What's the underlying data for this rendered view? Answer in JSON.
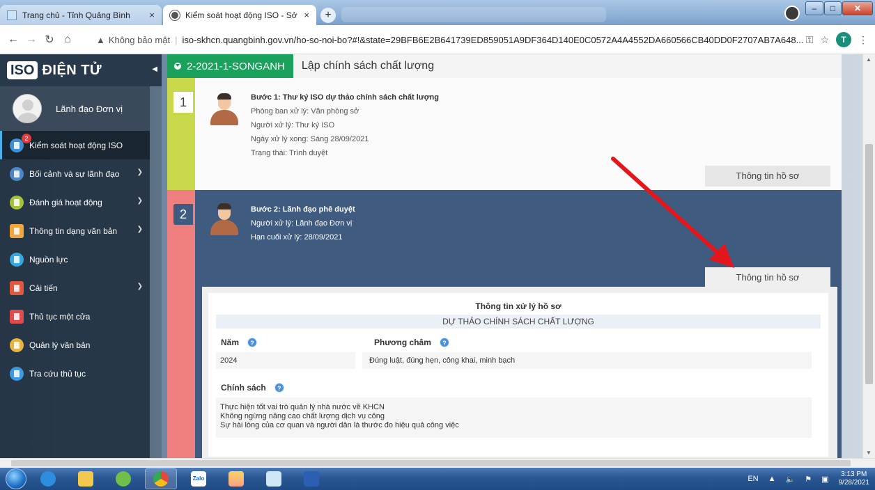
{
  "browser": {
    "tabs": [
      {
        "title": "Trang chủ - Tỉnh Quảng Bình",
        "active": false
      },
      {
        "title": "Kiểm soát hoạt động ISO - Sở Kh",
        "active": true
      }
    ],
    "new_tab_label": "+",
    "close_glyph": "×",
    "security_text": "Không bảo mật",
    "url": "iso-skhcn.quangbinh.gov.vn/ho-so-noi-bo?#!&state=29BFB6E2B641739ED859051A9DF364D140E0C0572A4A4552DA660566CB40DD0F2707AB7A648...",
    "profile_initial": "T"
  },
  "sidebar": {
    "logo_iso": "ISO",
    "logo_rest": "ĐIỆN TỬ",
    "user_name": "Lãnh đạo Đơn vị",
    "items": [
      {
        "label": "Kiểm soát hoạt động ISO",
        "badge": "2",
        "color": "#3f8fd4",
        "icon": "iso-icon",
        "expandable": false,
        "active": true
      },
      {
        "label": "Bối cảnh và sự lãnh đạo",
        "color": "#4b86c6",
        "icon": "document-icon",
        "expandable": true
      },
      {
        "label": "Đánh giá hoạt động",
        "color": "#a6c43a",
        "icon": "clipboard-icon",
        "expandable": true
      },
      {
        "label": "Thông tin dạng văn bản",
        "color": "#f0a63a",
        "icon": "file-text-icon",
        "expandable": true
      },
      {
        "label": "Nguồn lực",
        "color": "#35a8e0",
        "icon": "users-icon",
        "expandable": false
      },
      {
        "label": "Cải tiến",
        "color": "#e2573e",
        "icon": "chart-icon",
        "expandable": true
      },
      {
        "label": "Thủ tục một cửa",
        "color": "#e04a4a",
        "icon": "procedure-icon",
        "expandable": false
      },
      {
        "label": "Quản lý văn bản",
        "color": "#e8b43c",
        "icon": "folder-icon",
        "expandable": false
      },
      {
        "label": "Tra cứu thủ tục",
        "color": "#3a9be0",
        "icon": "search-icon",
        "expandable": false
      }
    ]
  },
  "header": {
    "code": "2-2021-1-SONGANH",
    "title": "Lập chính sách chất lượng"
  },
  "steps": [
    {
      "number": "1",
      "title": "Bước 1: Thư ký ISO dự thảo chính sách chất lượng",
      "lines": [
        "Phòng ban xử lý: Văn phòng sở",
        "Người xử lý: Thư ký ISO",
        "Ngày xử lý xong: Sáng 28/09/2021",
        "Trạng thái: Trình duyệt"
      ],
      "button": "Thông tin hồ sơ",
      "bar_color": "#c8d84a"
    },
    {
      "number": "2",
      "title": "Bước 2: Lãnh đạo phê duyệt",
      "lines": [
        "Người xử lý: Lãnh đạo Đơn vị",
        "Hạn cuối xử lý: 28/09/2021"
      ],
      "button": "Thông tin hồ sơ",
      "bar_color": "#ef7f7f"
    }
  ],
  "record_panel": {
    "heading": "Thông tin xử lý hồ sơ",
    "subheading": "DỰ THẢO CHÍNH SÁCH CHẤT LƯỢNG",
    "help_glyph": "?",
    "year_label": "Năm",
    "year_value": "2024",
    "motto_label": "Phương châm",
    "motto_value": "Đúng luật, đúng hẹn, công khai, minh bạch",
    "policy_label": "Chính sách",
    "policy_lines": [
      "Thực hiện tốt vai trò quản lý nhà nước về KHCN",
      "Không ngừng nâng cao chất lượng dịch vụ công",
      "Sự hài lòng của cơ quan và người dân là thước đo hiệu quả công việc"
    ]
  },
  "taskbar": {
    "apps": [
      "ie-icon",
      "explorer-icon",
      "app-g-icon",
      "chrome-icon",
      "zalo-icon",
      "media-icon",
      "paint-icon",
      "word-icon"
    ],
    "zalo_label": "Zalo",
    "lang": "EN",
    "time": "3:13 PM",
    "date": "9/28/2021"
  },
  "colors": {
    "accent_green": "#1aa15b",
    "step_blue": "#3f5c80",
    "arrow_red": "#e3171b"
  }
}
